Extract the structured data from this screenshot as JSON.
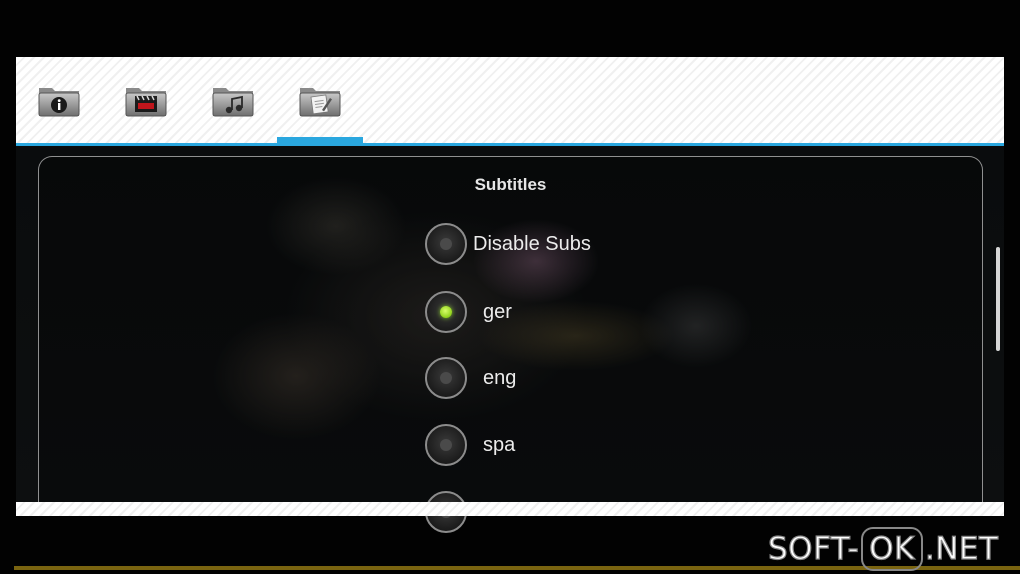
{
  "tabs": [
    {
      "icon": "info-folder-icon",
      "glyph": "i",
      "selected": false
    },
    {
      "icon": "video-folder-icon",
      "glyph": "clapper",
      "selected": false
    },
    {
      "icon": "audio-folder-icon",
      "glyph": "note",
      "selected": false
    },
    {
      "icon": "subtitles-folder-icon",
      "glyph": "doc",
      "selected": true
    }
  ],
  "dialog": {
    "title": "Subtitles",
    "options": [
      {
        "label": "Disable Subs",
        "checked": false
      },
      {
        "label": "ger",
        "checked": true
      },
      {
        "label": "eng",
        "checked": false
      },
      {
        "label": "spa",
        "checked": false
      }
    ]
  },
  "watermark": {
    "left": "SOFT-",
    "boxed": "OK",
    "right": ".NET"
  },
  "colors": {
    "accent": "#2aa7df",
    "radio_checked": "#8fd11a",
    "bottom_line": "#7a6410"
  }
}
